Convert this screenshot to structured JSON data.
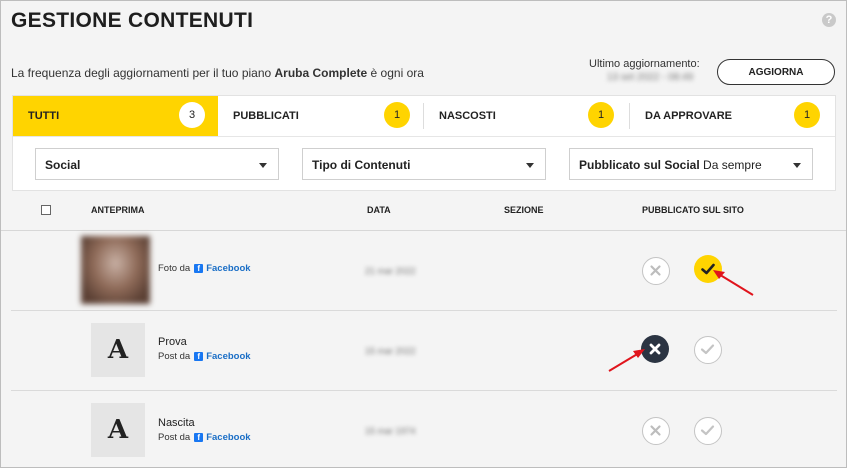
{
  "header": {
    "title": "GESTIONE CONTENUTI",
    "help_symbol": "?",
    "freq_prefix": "La frequenza degli aggiornamenti per il tuo piano ",
    "plan": "Aruba Complete",
    "freq_suffix": " è ogni ora",
    "last_update_label": "Ultimo aggiornamento:",
    "last_update_value": "13 set 2022 - 08:49",
    "refresh_label": "AGGIORNA"
  },
  "tabs": [
    {
      "label": "TUTTI",
      "count": "3",
      "active": true
    },
    {
      "label": "PUBBLICATI",
      "count": "1",
      "active": false
    },
    {
      "label": "NASCOSTI",
      "count": "1",
      "active": false
    },
    {
      "label": "DA APPROVARE",
      "count": "1",
      "active": false
    }
  ],
  "filters": {
    "social": {
      "label": "Social"
    },
    "content_type": {
      "label": "Tipo di Contenuti"
    },
    "published": {
      "label": "Pubblicato sul Social",
      "value": "Da sempre"
    }
  },
  "table": {
    "columns": {
      "preview": "ANTEPRIMA",
      "date": "DATA",
      "section": "SEZIONE",
      "published": "PUBBLICATO SUL SITO"
    },
    "rows": [
      {
        "thumb": "photo",
        "title": "",
        "source_prefix": "Foto da",
        "source": "Facebook",
        "date": "21 mar 2022",
        "status": "published"
      },
      {
        "thumb": "A",
        "title": "Prova",
        "source_prefix": "Post da",
        "source": "Facebook",
        "date": "15 mar 2022",
        "status": "hidden"
      },
      {
        "thumb": "A",
        "title": "Nascita",
        "source_prefix": "Post da",
        "source": "Facebook",
        "date": "15 mar 1974",
        "status": "pending"
      }
    ]
  },
  "colors": {
    "accent": "#ffd400",
    "dark_button": "#2b3442",
    "link": "#1a6ec6",
    "facebook": "#1877f2",
    "annotation_arrow": "#e0141c"
  },
  "icons": {
    "reject": "close-icon",
    "approve": "check-icon",
    "help": "question-circle-icon",
    "dropdown": "caret-down-icon"
  }
}
